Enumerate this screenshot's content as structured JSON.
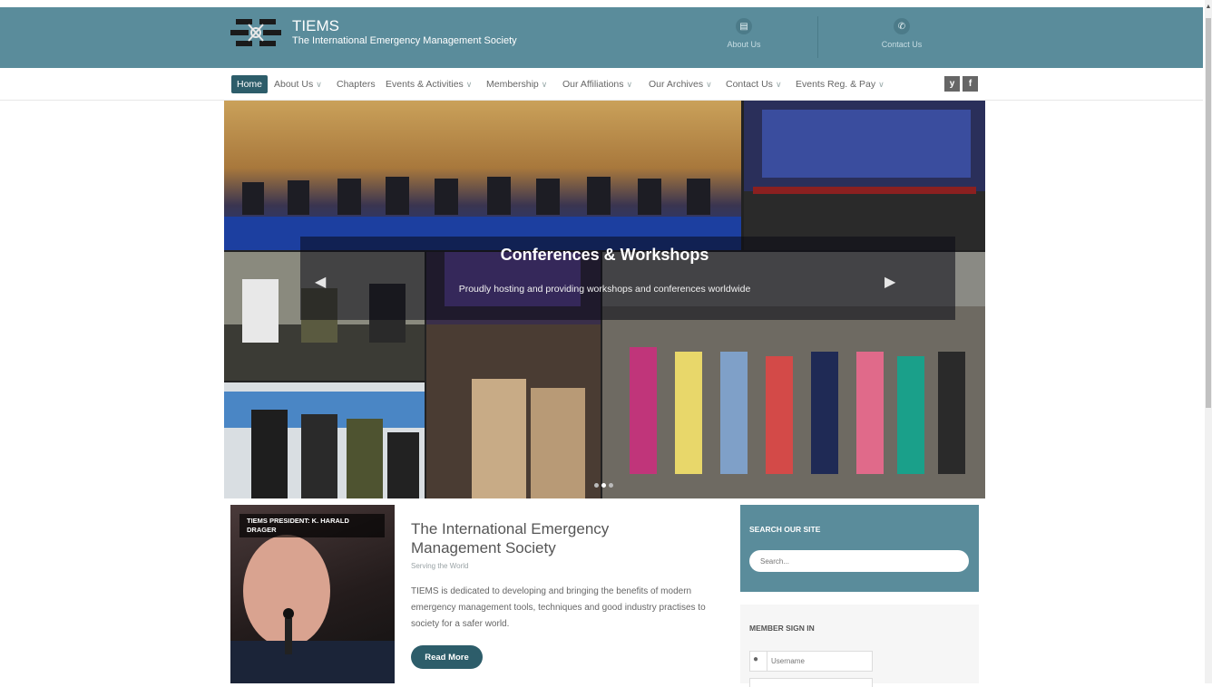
{
  "header": {
    "brand_name": "TIEMS",
    "brand_tagline": "The International Emergency Management Society",
    "about_label": "About Us",
    "contact_label": "Contact Us"
  },
  "nav": {
    "items": [
      {
        "label": "Home"
      },
      {
        "label": "About Us"
      },
      {
        "label": "Chapters"
      },
      {
        "label": "Events & Activities"
      },
      {
        "label": "Membership"
      },
      {
        "label": "Our Affiliations"
      },
      {
        "label": "Our Archives"
      },
      {
        "label": "Contact Us"
      },
      {
        "label": "Events Reg. & Pay"
      }
    ],
    "twitter_glyph": "y",
    "facebook_glyph": "f"
  },
  "slider": {
    "title": "Conferences & Workshops",
    "subtitle": "Proudly hosting and providing workshops and conferences worldwide",
    "dot_count": 3,
    "active_dot": 1
  },
  "president": {
    "label": "TIEMS PRESIDENT: K. HARALD DRAGER"
  },
  "intro": {
    "title": "The International Emergency Management Society",
    "subtitle": "Serving the World",
    "body": "TIEMS is dedicated to developing and bringing the benefits of modern emergency management tools, techniques and good industry practises to society for a safer world.",
    "button": "Read More"
  },
  "search": {
    "title": "SEARCH OUR SITE",
    "placeholder": "Search..."
  },
  "signin": {
    "title": "MEMBER SIGN IN",
    "username_placeholder": "Username"
  },
  "colors": {
    "header_bg": "#5a8c9b",
    "accent_dark": "#2d5d6a"
  },
  "icons": {
    "about": "id-card-icon",
    "contact": "phone-icon",
    "user": "user-icon"
  }
}
